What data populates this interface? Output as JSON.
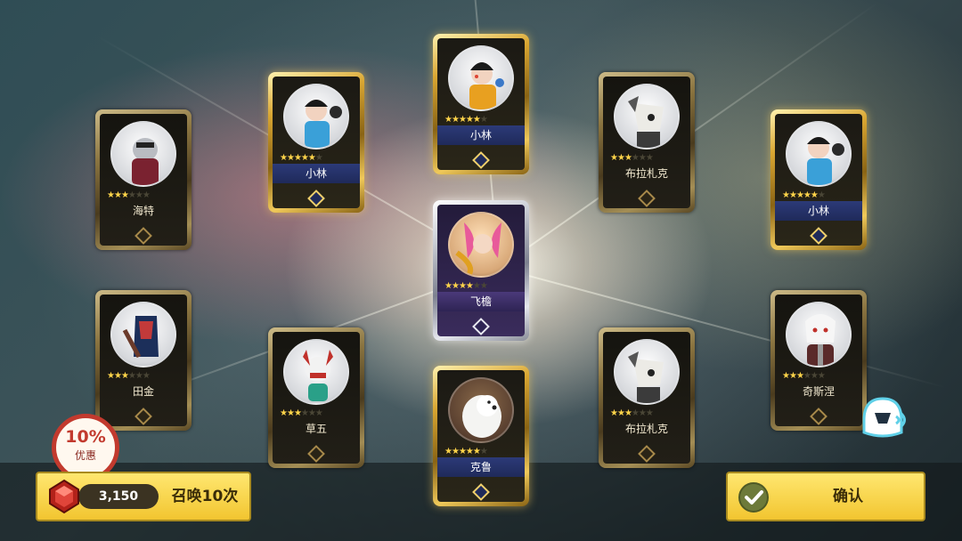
{
  "cards": [
    {
      "name": "海特",
      "stars": 3,
      "tier": "bronze"
    },
    {
      "name": "小林",
      "stars": 5,
      "tier": "gold"
    },
    {
      "name": "小林",
      "stars": 5,
      "tier": "gold"
    },
    {
      "name": "布拉札克",
      "stars": 3,
      "tier": "bronze"
    },
    {
      "name": "小林",
      "stars": 5,
      "tier": "gold"
    },
    {
      "name": "飞檐",
      "stars": 4,
      "tier": "silver"
    },
    {
      "name": "田金",
      "stars": 3,
      "tier": "bronze"
    },
    {
      "name": "草五",
      "stars": 3,
      "tier": "bronze"
    },
    {
      "name": "克鲁",
      "stars": 5,
      "tier": "gold"
    },
    {
      "name": "布拉札克",
      "stars": 3,
      "tier": "bronze"
    },
    {
      "name": "奇斯涅",
      "stars": 3,
      "tier": "bronze"
    }
  ],
  "max_stars": 6,
  "discount": {
    "percent": "10%",
    "label": "优惠"
  },
  "summon": {
    "cost": "3,150",
    "label": "召唤10次",
    "icon": "red-gem-icon"
  },
  "confirm": {
    "label": "确认",
    "icon": "check-icon"
  },
  "support": {
    "icon": "chat-helmet-icon"
  },
  "colors": {
    "button": "#f2c530",
    "gold_frame": "#d9a632",
    "star": "#ffd44a",
    "badge_red": "#c23a2e"
  }
}
